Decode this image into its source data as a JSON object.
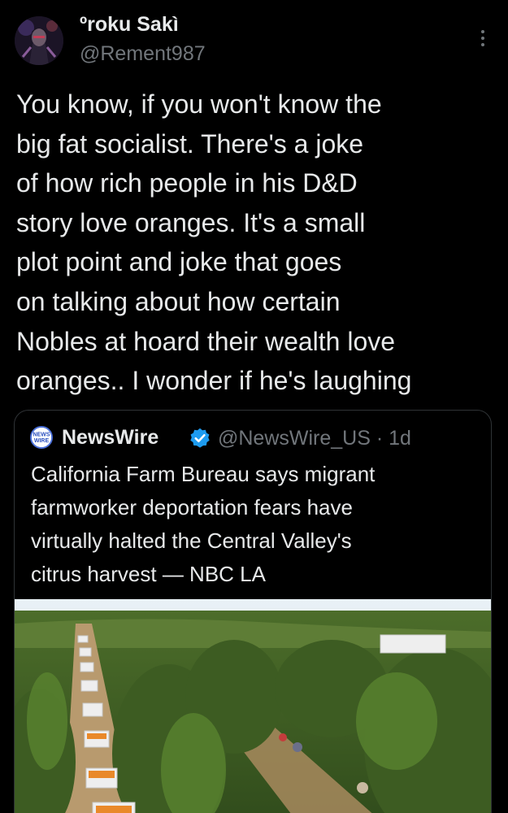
{
  "author": {
    "display_name": "ºroku Sakì",
    "handle": "@Rement987",
    "avatar_icon": "avatar-image"
  },
  "menu": {
    "icon": "more-vertical-icon"
  },
  "tweet": {
    "lines": [
      "You know, if you won't know the",
      "big fat socialist. There's a joke",
      "of how rich people in his D&D",
      "story love oranges. It's a small",
      "plot point and joke that goes",
      "on talking about how certain",
      "Nobles at hoard their wealth love",
      "oranges.. I wonder if he's laughing"
    ]
  },
  "quote": {
    "logo_text": [
      "NEWS",
      "WIRE"
    ],
    "name": "NewsWire",
    "verified_icon": "verified-badge-icon",
    "handle_time": "@NewsWire_US · 1d",
    "lines": [
      "California Farm Bureau says migrant",
      "farmworker deportation fears have",
      "virtually halted the Central Valley's",
      "citrus harvest — NBC LA"
    ],
    "image_icon": "orchard-photo"
  },
  "colors": {
    "background": "#000000",
    "text": "#e7e9ea",
    "secondary_text": "#71767b",
    "border": "#2f3336",
    "verified": "#1d9bf0"
  }
}
